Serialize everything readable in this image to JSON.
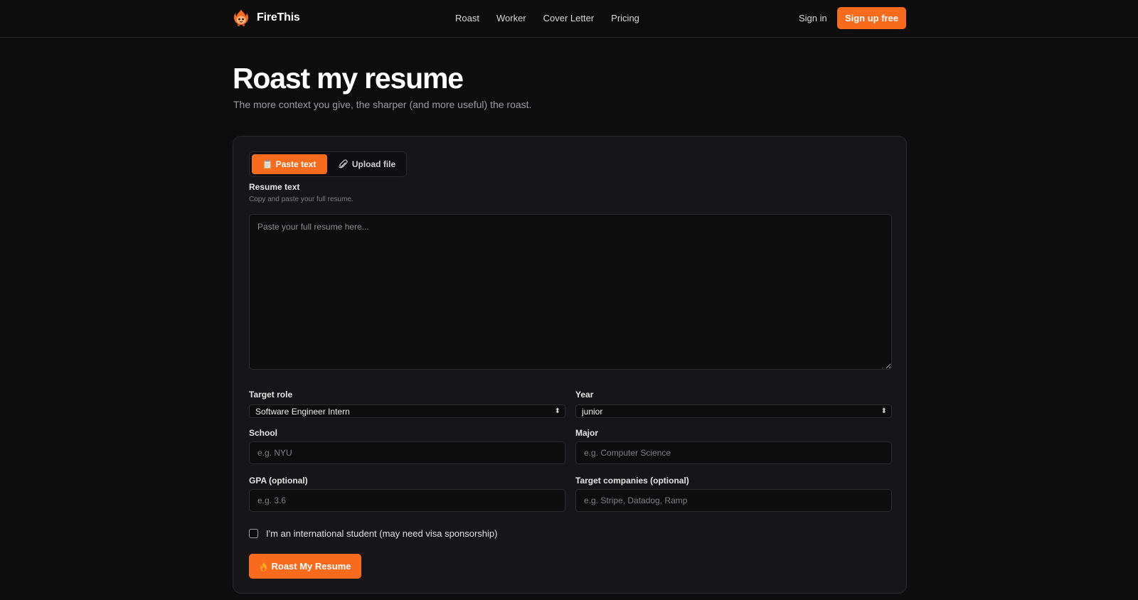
{
  "header": {
    "brand": "FireThis",
    "nav": [
      "Roast",
      "Worker",
      "Cover Letter",
      "Pricing"
    ],
    "signin": "Sign in",
    "signup": "Sign up free"
  },
  "page": {
    "title": "Roast my resume",
    "subtitle": "The more context you give, the sharper (and more useful) the roast."
  },
  "form": {
    "tabs": {
      "paste": "Paste text",
      "upload": "Upload file"
    },
    "resume_label": "Resume text",
    "resume_hint": "Copy and paste your full resume.",
    "resume_placeholder": "Paste your full resume here...",
    "target_role_label": "Target role",
    "target_role_value": "Software Engineer Intern",
    "year_label": "Year",
    "year_value": "junior",
    "school_label": "School",
    "school_placeholder": "e.g. NYU",
    "major_label": "Major",
    "major_placeholder": "e.g. Computer Science",
    "gpa_label": "GPA (optional)",
    "gpa_placeholder": "e.g. 3.6",
    "companies_label": "Target companies (optional)",
    "companies_placeholder": "e.g. Stripe, Datadog, Ramp",
    "international_label": "I'm an international student (may need visa sponsorship)",
    "submit_label": "Roast My Resume"
  },
  "colors": {
    "accent": "#f96b1c",
    "background": "#0d0d0e",
    "card": "#161618"
  },
  "icons": {
    "logo": "fire-mascot-icon",
    "paste_tab": "clipboard-icon",
    "upload_tab": "paperclip-icon",
    "submit": "fire-icon"
  }
}
